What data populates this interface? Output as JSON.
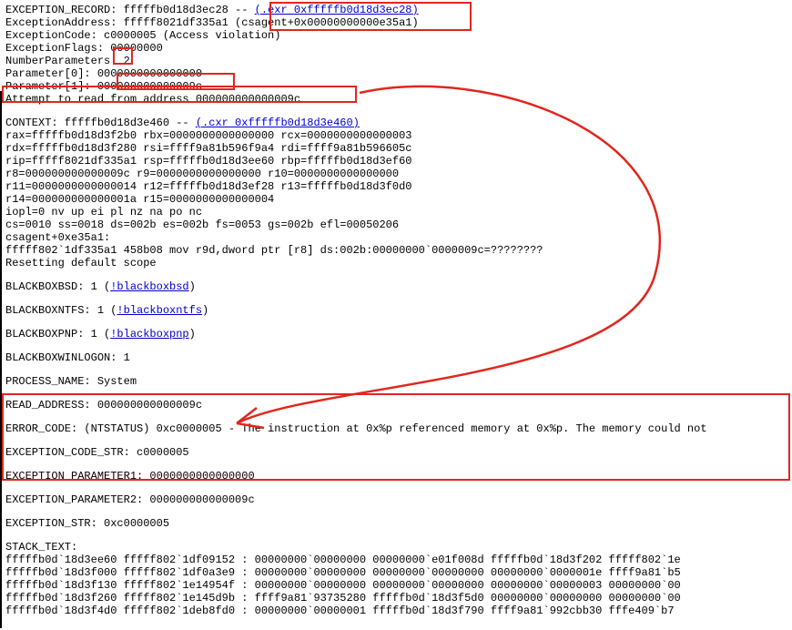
{
  "lines": {
    "l0a": "EXCEPTION_RECORD:  fffffb0d18d3ec28 -- ",
    "l0link": "(.exr 0xfffffb0d18d3ec28)",
    "l1a": "ExceptionAddress: fffff8021df335a1",
    "l1b": " (csagent+0x00000000000e35a1)",
    "l2": "   ExceptionCode: c0000005 (Access violation)",
    "l3": "  ExceptionFlags: 00000000",
    "l4": "NumberParameters: 2",
    "l5": "   Parameter[0]: 0000000000000000",
    "l6": "   Parameter[1]: 000000000000009c",
    "l7": "Attempt to read from address 000000000000009c",
    "l9a": "CONTEXT:  fffffb0d18d3e460 -- ",
    "l9link": "(.cxr 0xfffffb0d18d3e460)",
    "l10": "rax=fffffb0d18d3f2b0 rbx=0000000000000000 rcx=0000000000000003",
    "l11": "rdx=fffffb0d18d3f280 rsi=ffff9a81b596f9a4 rdi=ffff9a81b596605c",
    "l12": "rip=fffff8021df335a1 rsp=fffffb0d18d3ee60 rbp=fffffb0d18d3ef60",
    "l13": " r8=000000000000009c  r9=0000000000000000 r10=0000000000000000",
    "l14": "r11=0000000000000014 r12=fffffb0d18d3ef28 r13=fffffb0d18d3f0d0",
    "l15": "r14=000000000000001a r15=0000000000000004",
    "l16": "iopl=0         nv up ei pl nz na po nc",
    "l17": "cs=0010  ss=0018  ds=002b  es=002b  fs=0053  gs=002b             efl=00050206",
    "l18": "csagent+0xe35a1:",
    "l19": "fffff802`1df335a1 458b08          mov     r9d,dword ptr [r8] ds:002b:00000000`0000009c=????????",
    "l20": "Resetting default scope",
    "bbsd_a": "BLACKBOXBSD: 1 (",
    "bbsd_link": "!blackboxbsd",
    "bbsd_b": ")",
    "bntfs_a": "BLACKBOXNTFS: 1 (",
    "bntfs_link": "!blackboxntfs",
    "bntfs_b": ")",
    "bpnp_a": "BLACKBOXPNP: 1 (",
    "bpnp_link": "!blackboxpnp",
    "bpnp_b": ")",
    "bwin": "BLACKBOXWINLOGON: 1",
    "pname": "PROCESS_NAME:  System",
    "raddr": "READ_ADDRESS:  000000000000009c ",
    "ecode": "ERROR_CODE: (NTSTATUS) 0xc0000005 - The instruction at 0x%p referenced memory at 0x%p. The memory could not",
    "ecstr": "EXCEPTION_CODE_STR:  c0000005",
    "ep1": "EXCEPTION_PARAMETER1:  0000000000000000",
    "ep2": "EXCEPTION_PARAMETER2:  000000000000009c",
    "exstr": "EXCEPTION_STR:  0xc0000005",
    "stlab": "STACK_TEXT:  ",
    "st1": "fffffb0d`18d3ee60 fffff802`1df09152     : 00000000`00000000 00000000`e01f008d fffffb0d`18d3f202 fffff802`1e",
    "st2": "fffffb0d`18d3f000 fffff802`1df0a3e9     : 00000000`00000000 00000000`00000000 00000000`0000001e ffff9a81`b5",
    "st3": "fffffb0d`18d3f130 fffff802`1e14954f     : 00000000`00000000 00000000`00000000 00000000`00000003 00000000`00",
    "st4": "fffffb0d`18d3f260 fffff802`1e145d9b     : ffff9a81`93735280 fffffb0d`18d3f5d0 00000000`00000000 00000000`00",
    "st5": "fffffb0d`18d3f4d0 fffff802`1deb8fd0     : 00000000`00000001 fffffb0d`18d3f790 ffff9a81`992cbb30 fffe409`b7"
  }
}
